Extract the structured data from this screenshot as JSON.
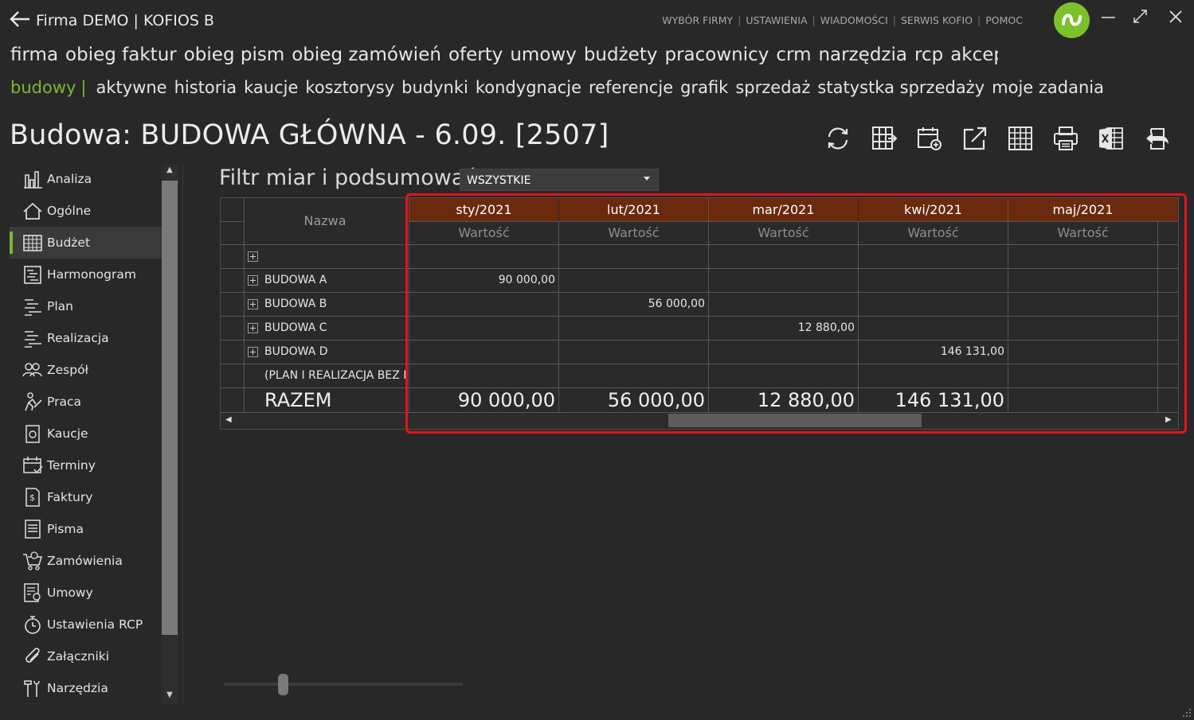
{
  "app": {
    "title": "Firma DEMO | KOFIOS B",
    "top_links": [
      "WYBÓR FIRMY",
      "USTAWIENIA",
      "WIADOMOŚCI",
      "SERWIS KOFIO",
      "POMOC"
    ],
    "link_separator": "|"
  },
  "menu_main": [
    "firma",
    "obieg faktur",
    "obieg pism",
    "obieg zamówień",
    "oferty",
    "umowy",
    "budżety",
    "pracownicy",
    "crm",
    "narzędzia",
    "rcp",
    "akceptacje rok"
  ],
  "menu_sub": {
    "active": "budowy",
    "separator": "|",
    "items": [
      "aktywne",
      "historia",
      "kaucje",
      "kosztorysy",
      "budynki",
      "kondygnacje",
      "referencje",
      "grafik",
      "sprzedaż",
      "statystka sprzedaży",
      "moje zadania"
    ]
  },
  "page": {
    "title": "Budowa: BUDOWA GŁÓWNA - 6.09. [2507]"
  },
  "toolbar_icons": [
    "refresh-icon",
    "grid-export-icon",
    "calendar-add-icon",
    "open-external-icon",
    "table-icon",
    "print-icon",
    "excel-icon",
    "exit-icon"
  ],
  "sidebar": {
    "items": [
      {
        "label": "Analiza",
        "icon": "bar-chart-icon"
      },
      {
        "label": "Ogólne",
        "icon": "home-icon"
      },
      {
        "label": "Budżet",
        "icon": "table-icon",
        "active": true
      },
      {
        "label": "Harmonogram",
        "icon": "schedule-icon"
      },
      {
        "label": "Plan",
        "icon": "list-indent-icon"
      },
      {
        "label": "Realizacja",
        "icon": "list-indent-icon"
      },
      {
        "label": "Zespół",
        "icon": "team-icon"
      },
      {
        "label": "Praca",
        "icon": "worker-icon"
      },
      {
        "label": "Kaucje",
        "icon": "deposit-icon"
      },
      {
        "label": "Terminy",
        "icon": "calendar-check-icon"
      },
      {
        "label": "Faktury",
        "icon": "invoice-icon"
      },
      {
        "label": "Pisma",
        "icon": "document-icon"
      },
      {
        "label": "Zamówienia",
        "icon": "cart-icon"
      },
      {
        "label": "Umowy",
        "icon": "contract-icon"
      },
      {
        "label": "Ustawienia RCP",
        "icon": "stopwatch-icon"
      },
      {
        "label": "Załączniki",
        "icon": "paperclip-icon"
      },
      {
        "label": "Narzędzia",
        "icon": "tools-icon"
      }
    ]
  },
  "filter": {
    "label": "Filtr miar i podsumowań",
    "selected": "WSZYSTKIE"
  },
  "grid": {
    "name_header": "Nazwa",
    "columns": [
      {
        "month": "sty/2021",
        "measure": "Wartość"
      },
      {
        "month": "lut/2021",
        "measure": "Wartość"
      },
      {
        "month": "mar/2021",
        "measure": "Wartość"
      },
      {
        "month": "kwi/2021",
        "measure": "Wartość"
      },
      {
        "month": "maj/2021",
        "measure": "Wartość"
      }
    ],
    "rows": [
      {
        "name": "",
        "values": [
          "",
          "",
          "",
          "",
          ""
        ]
      },
      {
        "name": "BUDOWA A",
        "values": [
          "90 000,00",
          "",
          "",
          "",
          ""
        ]
      },
      {
        "name": "BUDOWA B",
        "values": [
          "",
          "56 000,00",
          "",
          "",
          ""
        ]
      },
      {
        "name": "BUDOWA C",
        "values": [
          "",
          "",
          "12 880,00",
          "",
          ""
        ]
      },
      {
        "name": "BUDOWA D",
        "values": [
          "",
          "",
          "",
          "146 131,00",
          ""
        ]
      },
      {
        "name": "(PLAN I REALIZACJA BEZ EI",
        "values": [
          "",
          "",
          "",
          "",
          ""
        ]
      }
    ],
    "total": {
      "name": "RAZEM",
      "values": [
        "90 000,00",
        "56 000,00",
        "12 880,00",
        "146 131,00",
        ""
      ]
    }
  },
  "colors": {
    "accent": "#7cb82f",
    "header_bg": "#6b2a0e",
    "highlight": "#e3141c",
    "background": "#282828"
  }
}
